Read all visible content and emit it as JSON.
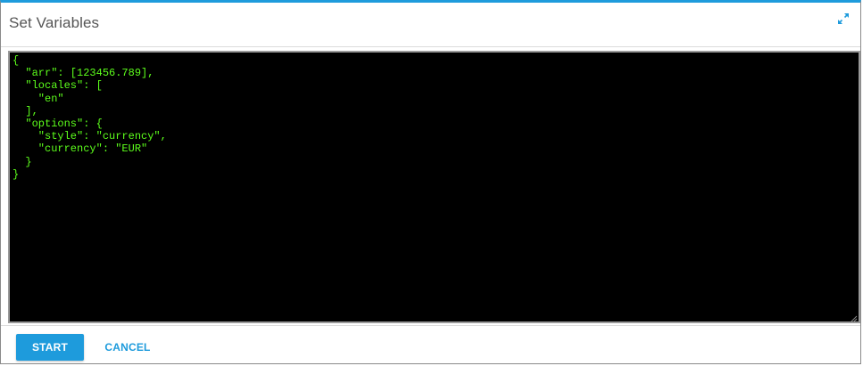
{
  "dialog": {
    "title": "Set Variables",
    "accent_color": "#1e9bdc",
    "expand_icon": "expand-arrows-icon"
  },
  "editor": {
    "content": "{\n  \"arr\": [123456.789],\n  \"locales\": [\n    \"en\"\n  ],\n  \"options\": {\n    \"style\": \"currency\",\n    \"currency\": \"EUR\"\n  }\n}",
    "background_color": "#000000",
    "text_color": "#5dff1c"
  },
  "footer": {
    "start_label": "START",
    "cancel_label": "CANCEL"
  }
}
